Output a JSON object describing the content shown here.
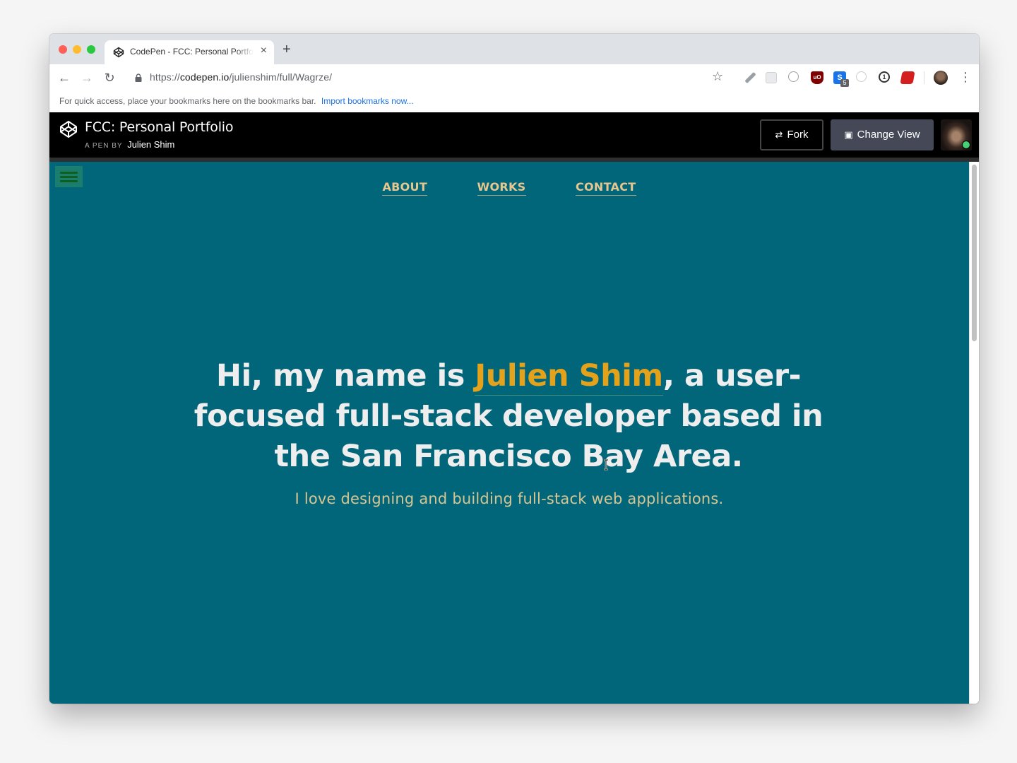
{
  "browser": {
    "tab_title": "CodePen - FCC: Personal Portfolio",
    "new_tab": "+",
    "close": "×",
    "url_prefix": "https://",
    "url_host": "codepen.io",
    "url_path": "/julienshim/full/Wagrze/",
    "bookmarks_text": "For quick access, place your bookmarks here on the bookmarks bar.",
    "bookmarks_link": "Import bookmarks now...",
    "extension_badge": "5"
  },
  "codepen": {
    "pen_title": "FCC: Personal Portfolio",
    "by_label": "A PEN BY",
    "author": "Julien Shim",
    "fork_label": "Fork",
    "change_view_label": "Change View"
  },
  "site": {
    "nav": [
      "ABOUT",
      "WORKS",
      "CONTACT"
    ],
    "hero_before": "Hi, my name is ",
    "hero_name": "Julien Shim",
    "hero_after": ", a user-focused full-stack developer based in the San Francisco Bay Area.",
    "subtitle": "I love designing and building full-stack web applications."
  },
  "colors": {
    "page_background": "#02667a",
    "accent_name": "#e3a21a",
    "nav_link": "#e6c78f",
    "codepen_header": "#000000"
  }
}
